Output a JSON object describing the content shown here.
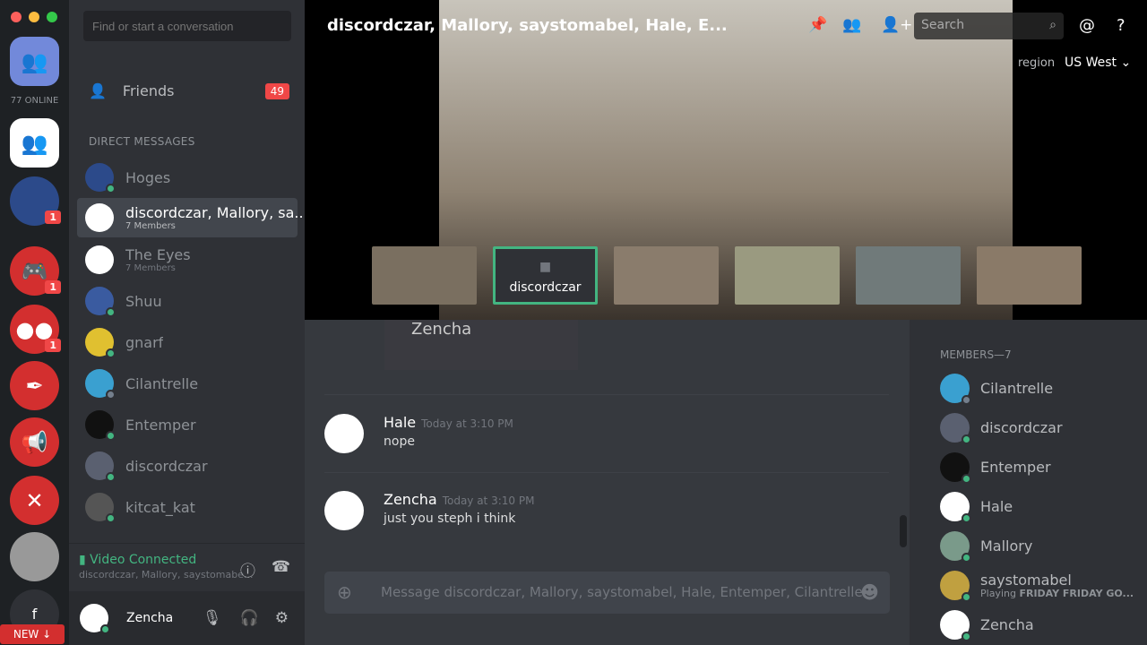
{
  "guilds": {
    "online": "77 ONLINE",
    "badges": [
      "1",
      "1",
      "1"
    ],
    "new_label": "NEW ↓",
    "facebook": "f"
  },
  "dms": {
    "search_placeholder": "Find or start a conversation",
    "friends": "Friends",
    "friends_count": "49",
    "header": "DIRECT MESSAGES",
    "items": [
      {
        "name": "Hoges"
      },
      {
        "name": "discordczar, Mallory, sa...",
        "sub": "7 Members"
      },
      {
        "name": "The Eyes",
        "sub": "7 Members"
      },
      {
        "name": "Shuu"
      },
      {
        "name": "gnarf"
      },
      {
        "name": "Cilantrelle"
      },
      {
        "name": "Entemper"
      },
      {
        "name": "discordczar"
      },
      {
        "name": "kitcat_kat"
      }
    ]
  },
  "voice": {
    "status": "Video Connected",
    "channel": "discordczar, Mallory, saystomabe..."
  },
  "user": {
    "name": "Zencha"
  },
  "header": {
    "title": "discordczar, Mallory, saystomabel, Hale, E...",
    "search_placeholder": "Search",
    "region_label": "region",
    "region": "US West ⌄"
  },
  "video": {
    "active_thumb": "discordczar",
    "overlay_text": "Zencha"
  },
  "messages": [
    {
      "author": "Hale",
      "time": "Today at 3:10 PM",
      "text": "nope"
    },
    {
      "author": "Zencha",
      "time": "Today at 3:10 PM",
      "text": "just you steph i think"
    }
  ],
  "composer": {
    "placeholder": "Message discordczar, Mallory, saystomabel, Hale, Entemper, Cilantrelle"
  },
  "members": {
    "header": "MEMBERS—7",
    "items": [
      {
        "name": "Cilantrelle"
      },
      {
        "name": "discordczar"
      },
      {
        "name": "Entemper"
      },
      {
        "name": "Hale"
      },
      {
        "name": "Mallory"
      },
      {
        "name": "saystomabel",
        "activity_prefix": "Playing",
        "activity": "FRIDAY FRIDAY GO..."
      },
      {
        "name": "Zencha"
      }
    ]
  },
  "colors": {
    "accent": "#7289da",
    "online": "#43b581",
    "badge": "#f04747"
  }
}
